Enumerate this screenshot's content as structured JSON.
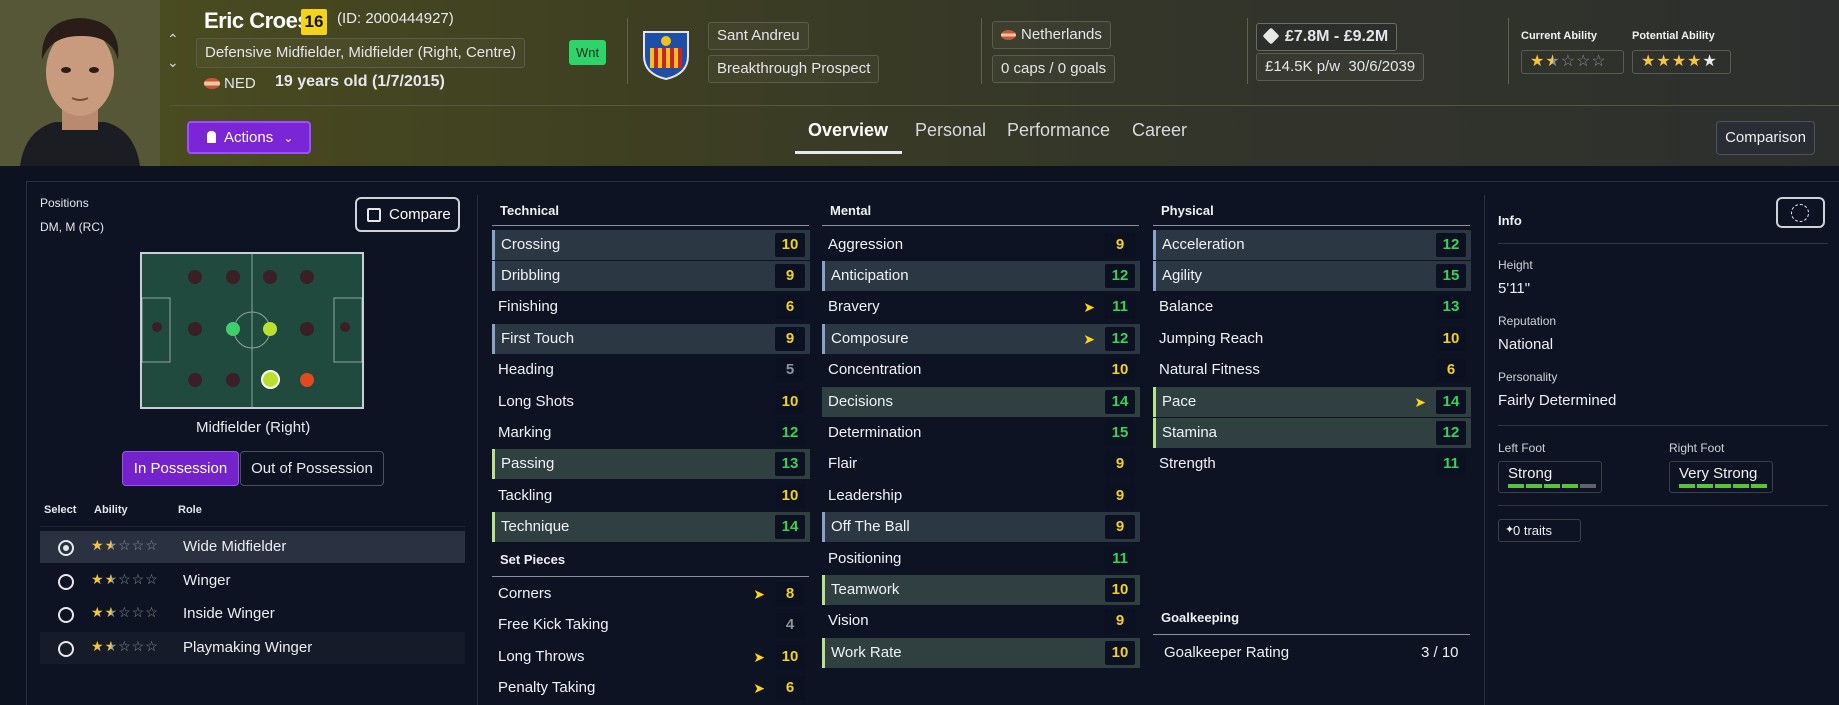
{
  "player": {
    "name": "Eric Croes",
    "shirt_number": "16",
    "id_text": "(ID: 2000444927)",
    "positions_text": "Defensive Midfielder, Midfielder (Right, Centre)",
    "nationality_short": "NED",
    "age_text": "19 years old (1/7/2015)",
    "wnt_badge": "Wnt"
  },
  "club": {
    "name": "Sant Andreu",
    "status": "Breakthrough Prospect"
  },
  "nation": {
    "name": "Netherlands",
    "caps": "0 caps / 0 goals"
  },
  "contract": {
    "value": "£7.8M - £9.2M",
    "wage": "£14.5K p/w",
    "expiry": "30/6/2039"
  },
  "abilities": {
    "current_label": "Current Ability",
    "current_stars": 1.5,
    "potential_label": "Potential Ability",
    "potential_stars": 5
  },
  "nav": {
    "actions_label": "Actions",
    "tabs": [
      "Overview",
      "Personal",
      "Performance",
      "Career"
    ],
    "active_tab": "Overview",
    "comparison_label": "Comparison"
  },
  "positions_panel": {
    "title": "Positions",
    "short_positions": "DM, M (RC)",
    "compare_label": "Compare",
    "selected_position": "Midfielder (Right)",
    "toggle": [
      "In Possession",
      "Out of Possession"
    ],
    "active_toggle": "In Possession",
    "columns": [
      "Select",
      "Ability",
      "Role"
    ],
    "roles": [
      {
        "name": "Wide Midfielder",
        "stars": 1.5,
        "selected": true
      },
      {
        "name": "Winger",
        "stars": 1.5,
        "selected": false
      },
      {
        "name": "Inside Winger",
        "stars": 1.5,
        "selected": false
      },
      {
        "name": "Playmaking Winger",
        "stars": 1.5,
        "selected": false
      }
    ]
  },
  "technical": {
    "title": "Technical",
    "attributes": [
      {
        "name": "Crossing",
        "value": "10"
      },
      {
        "name": "Dribbling",
        "value": "9"
      },
      {
        "name": "Finishing",
        "value": "6"
      },
      {
        "name": "First Touch",
        "value": "9"
      },
      {
        "name": "Heading",
        "value": "5"
      },
      {
        "name": "Long Shots",
        "value": "10"
      },
      {
        "name": "Marking",
        "value": "12"
      },
      {
        "name": "Passing",
        "value": "13"
      },
      {
        "name": "Tackling",
        "value": "10"
      },
      {
        "name": "Technique",
        "value": "14"
      }
    ]
  },
  "set_pieces": {
    "title": "Set Pieces",
    "attributes": [
      {
        "name": "Corners",
        "value": "8"
      },
      {
        "name": "Free Kick Taking",
        "value": "4"
      },
      {
        "name": "Long Throws",
        "value": "10"
      },
      {
        "name": "Penalty Taking",
        "value": "6"
      }
    ]
  },
  "mental": {
    "title": "Mental",
    "attributes": [
      {
        "name": "Aggression",
        "value": "9"
      },
      {
        "name": "Anticipation",
        "value": "12"
      },
      {
        "name": "Bravery",
        "value": "11"
      },
      {
        "name": "Composure",
        "value": "12"
      },
      {
        "name": "Concentration",
        "value": "10"
      },
      {
        "name": "Decisions",
        "value": "14"
      },
      {
        "name": "Determination",
        "value": "15"
      },
      {
        "name": "Flair",
        "value": "9"
      },
      {
        "name": "Leadership",
        "value": "9"
      },
      {
        "name": "Off The Ball",
        "value": "9"
      },
      {
        "name": "Positioning",
        "value": "11"
      },
      {
        "name": "Teamwork",
        "value": "10"
      },
      {
        "name": "Vision",
        "value": "9"
      },
      {
        "name": "Work Rate",
        "value": "10"
      }
    ]
  },
  "physical": {
    "title": "Physical",
    "attributes": [
      {
        "name": "Acceleration",
        "value": "12"
      },
      {
        "name": "Agility",
        "value": "15"
      },
      {
        "name": "Balance",
        "value": "13"
      },
      {
        "name": "Jumping Reach",
        "value": "10"
      },
      {
        "name": "Natural Fitness",
        "value": "6"
      },
      {
        "name": "Pace",
        "value": "14"
      },
      {
        "name": "Stamina",
        "value": "12"
      },
      {
        "name": "Strength",
        "value": "11"
      }
    ]
  },
  "goalkeeping": {
    "title": "Goalkeeping",
    "rating_label": "Goalkeeper Rating",
    "rating_value": "3 / 10"
  },
  "info": {
    "title": "Info",
    "height_label": "Height",
    "height": "5'11\"",
    "reputation_label": "Reputation",
    "reputation": "National",
    "personality_label": "Personality",
    "personality": "Fairly Determined",
    "left_foot_label": "Left Foot",
    "left_foot": "Strong",
    "left_foot_level": 4,
    "right_foot_label": "Right Foot",
    "right_foot": "Very Strong",
    "right_foot_level": 5,
    "traits": "0 traits"
  },
  "colors": {
    "accent_purple": "#7a25d6",
    "value_yellow": "#f2d21c",
    "value_green": "#36d25b",
    "value_grey": "#8e939c",
    "shirt_yellow": "#f3d418"
  }
}
